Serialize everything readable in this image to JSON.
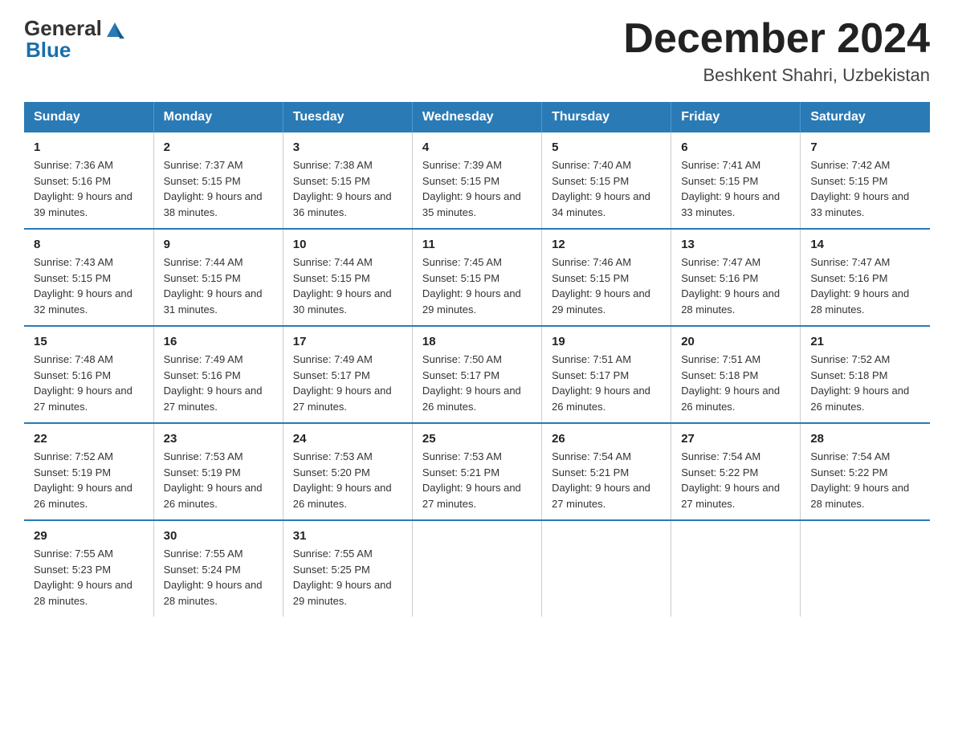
{
  "header": {
    "logo_general": "General",
    "logo_blue": "Blue",
    "month_title": "December 2024",
    "location": "Beshkent Shahri, Uzbekistan"
  },
  "days_of_week": [
    "Sunday",
    "Monday",
    "Tuesday",
    "Wednesday",
    "Thursday",
    "Friday",
    "Saturday"
  ],
  "weeks": [
    [
      {
        "day": "1",
        "sunrise": "7:36 AM",
        "sunset": "5:16 PM",
        "daylight": "9 hours and 39 minutes."
      },
      {
        "day": "2",
        "sunrise": "7:37 AM",
        "sunset": "5:15 PM",
        "daylight": "9 hours and 38 minutes."
      },
      {
        "day": "3",
        "sunrise": "7:38 AM",
        "sunset": "5:15 PM",
        "daylight": "9 hours and 36 minutes."
      },
      {
        "day": "4",
        "sunrise": "7:39 AM",
        "sunset": "5:15 PM",
        "daylight": "9 hours and 35 minutes."
      },
      {
        "day": "5",
        "sunrise": "7:40 AM",
        "sunset": "5:15 PM",
        "daylight": "9 hours and 34 minutes."
      },
      {
        "day": "6",
        "sunrise": "7:41 AM",
        "sunset": "5:15 PM",
        "daylight": "9 hours and 33 minutes."
      },
      {
        "day": "7",
        "sunrise": "7:42 AM",
        "sunset": "5:15 PM",
        "daylight": "9 hours and 33 minutes."
      }
    ],
    [
      {
        "day": "8",
        "sunrise": "7:43 AM",
        "sunset": "5:15 PM",
        "daylight": "9 hours and 32 minutes."
      },
      {
        "day": "9",
        "sunrise": "7:44 AM",
        "sunset": "5:15 PM",
        "daylight": "9 hours and 31 minutes."
      },
      {
        "day": "10",
        "sunrise": "7:44 AM",
        "sunset": "5:15 PM",
        "daylight": "9 hours and 30 minutes."
      },
      {
        "day": "11",
        "sunrise": "7:45 AM",
        "sunset": "5:15 PM",
        "daylight": "9 hours and 29 minutes."
      },
      {
        "day": "12",
        "sunrise": "7:46 AM",
        "sunset": "5:15 PM",
        "daylight": "9 hours and 29 minutes."
      },
      {
        "day": "13",
        "sunrise": "7:47 AM",
        "sunset": "5:16 PM",
        "daylight": "9 hours and 28 minutes."
      },
      {
        "day": "14",
        "sunrise": "7:47 AM",
        "sunset": "5:16 PM",
        "daylight": "9 hours and 28 minutes."
      }
    ],
    [
      {
        "day": "15",
        "sunrise": "7:48 AM",
        "sunset": "5:16 PM",
        "daylight": "9 hours and 27 minutes."
      },
      {
        "day": "16",
        "sunrise": "7:49 AM",
        "sunset": "5:16 PM",
        "daylight": "9 hours and 27 minutes."
      },
      {
        "day": "17",
        "sunrise": "7:49 AM",
        "sunset": "5:17 PM",
        "daylight": "9 hours and 27 minutes."
      },
      {
        "day": "18",
        "sunrise": "7:50 AM",
        "sunset": "5:17 PM",
        "daylight": "9 hours and 26 minutes."
      },
      {
        "day": "19",
        "sunrise": "7:51 AM",
        "sunset": "5:17 PM",
        "daylight": "9 hours and 26 minutes."
      },
      {
        "day": "20",
        "sunrise": "7:51 AM",
        "sunset": "5:18 PM",
        "daylight": "9 hours and 26 minutes."
      },
      {
        "day": "21",
        "sunrise": "7:52 AM",
        "sunset": "5:18 PM",
        "daylight": "9 hours and 26 minutes."
      }
    ],
    [
      {
        "day": "22",
        "sunrise": "7:52 AM",
        "sunset": "5:19 PM",
        "daylight": "9 hours and 26 minutes."
      },
      {
        "day": "23",
        "sunrise": "7:53 AM",
        "sunset": "5:19 PM",
        "daylight": "9 hours and 26 minutes."
      },
      {
        "day": "24",
        "sunrise": "7:53 AM",
        "sunset": "5:20 PM",
        "daylight": "9 hours and 26 minutes."
      },
      {
        "day": "25",
        "sunrise": "7:53 AM",
        "sunset": "5:21 PM",
        "daylight": "9 hours and 27 minutes."
      },
      {
        "day": "26",
        "sunrise": "7:54 AM",
        "sunset": "5:21 PM",
        "daylight": "9 hours and 27 minutes."
      },
      {
        "day": "27",
        "sunrise": "7:54 AM",
        "sunset": "5:22 PM",
        "daylight": "9 hours and 27 minutes."
      },
      {
        "day": "28",
        "sunrise": "7:54 AM",
        "sunset": "5:22 PM",
        "daylight": "9 hours and 28 minutes."
      }
    ],
    [
      {
        "day": "29",
        "sunrise": "7:55 AM",
        "sunset": "5:23 PM",
        "daylight": "9 hours and 28 minutes."
      },
      {
        "day": "30",
        "sunrise": "7:55 AM",
        "sunset": "5:24 PM",
        "daylight": "9 hours and 28 minutes."
      },
      {
        "day": "31",
        "sunrise": "7:55 AM",
        "sunset": "5:25 PM",
        "daylight": "9 hours and 29 minutes."
      },
      null,
      null,
      null,
      null
    ]
  ]
}
